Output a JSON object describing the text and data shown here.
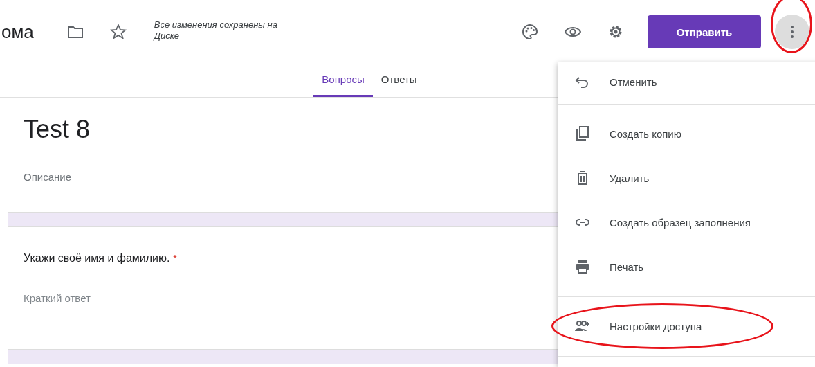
{
  "header": {
    "title": "ома",
    "save_status": "Все изменения сохранены на Диске",
    "send_button": "Отправить",
    "more_button": {
      "circled": true
    }
  },
  "tabs": [
    {
      "label": "Вопросы",
      "selected": true
    },
    {
      "label": "Ответы",
      "selected": false
    }
  ],
  "form": {
    "title": "Test 8",
    "description": "Описание",
    "question": {
      "text": "Укажи своё имя и фамилию.",
      "required_mark": "*",
      "placeholder": "Краткий ответ"
    }
  },
  "menu": {
    "groups": [
      [
        {
          "label": "Отменить",
          "circled": false
        }
      ],
      [
        {
          "label": "Создать копию",
          "circled": false
        },
        {
          "label": "Удалить",
          "circled": false
        },
        {
          "label": "Создать образец заполнения",
          "circled": false
        },
        {
          "label": "Печать",
          "circled": false
        }
      ],
      [
        {
          "label": "Настройки доступа",
          "circled": true
        }
      ]
    ]
  }
}
